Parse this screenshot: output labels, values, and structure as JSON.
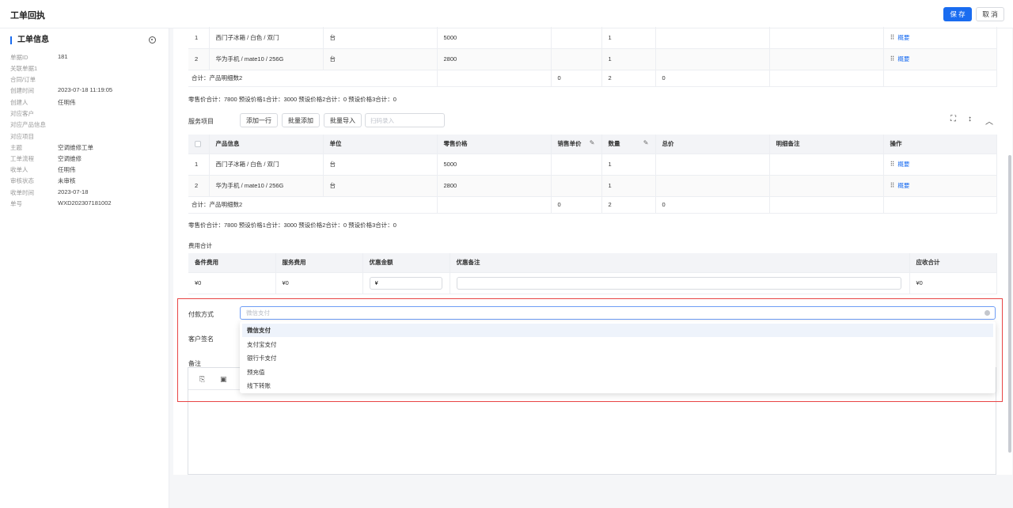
{
  "header": {
    "title": "工单回执",
    "save_label": "保 存",
    "cancel_label": "取 消"
  },
  "sidebar": {
    "title": "工单信息",
    "rows": [
      {
        "k": "单据ID",
        "v": "181"
      },
      {
        "k": "关联单据1",
        "v": ""
      },
      {
        "k": "合同/订单",
        "v": ""
      },
      {
        "k": "创建时间",
        "v": "2023-07-18 11:19:05"
      },
      {
        "k": "创建人",
        "v": "任明伟"
      },
      {
        "k": "对应客户",
        "v": ""
      },
      {
        "k": "对应产品信息",
        "v": ""
      },
      {
        "k": "对应项目",
        "v": ""
      },
      {
        "k": "主题",
        "v": "空调维修工单"
      },
      {
        "k": "工单流程",
        "v": "空调维修"
      },
      {
        "k": "收单人",
        "v": "任明伟"
      },
      {
        "k": "审核状态",
        "v": "未审核"
      },
      {
        "k": "收单时间",
        "v": "2023-07-18"
      },
      {
        "k": "单号",
        "v": "WXD202307181002"
      }
    ]
  },
  "product_table": {
    "rows": [
      {
        "idx": "1",
        "name": "西门子冰箱 / 白色 / 双门",
        "unit": "台",
        "price": "5000",
        "qty": "1",
        "op": "概要"
      },
      {
        "idx": "2",
        "name": "华为手机 / mate10 / 256G",
        "unit": "台",
        "price": "2800",
        "qty": "1",
        "op": "概要"
      }
    ],
    "sum": {
      "label": "合计：产品明细数2",
      "sale": "0",
      "qty": "2",
      "total": "0"
    },
    "summary_line": "零售价合计：7800  预设价格1合计：3000  预设价格2合计：0  预设价格3合计：0"
  },
  "service": {
    "label": "服务项目",
    "btn_add_row": "添加一行",
    "btn_batch_add": "批量添加",
    "btn_batch_import": "批量导入",
    "scan_placeholder": "扫码录入",
    "headers": {
      "product": "产品信息",
      "unit": "单位",
      "retail": "零售价格",
      "sale": "销售单价",
      "qty": "数量",
      "total": "总价",
      "remark": "明细备注",
      "op": "操作"
    },
    "rows": [
      {
        "idx": "1",
        "name": "西门子冰箱 / 白色 / 双门",
        "unit": "台",
        "price": "5000",
        "qty": "1",
        "op": "概要"
      },
      {
        "idx": "2",
        "name": "华为手机 / mate10 / 256G",
        "unit": "台",
        "price": "2800",
        "qty": "1",
        "op": "概要"
      }
    ],
    "sum": {
      "label": "合计：产品明细数2",
      "sale": "0",
      "qty": "2",
      "total": "0"
    },
    "summary_line": "零售价合计：7800  预设价格1合计：3000  预设价格2合计：0  预设价格3合计：0"
  },
  "fees": {
    "title": "费用合计",
    "headers": {
      "parts": "备件费用",
      "service": "服务费用",
      "discount": "优惠金额",
      "discount_note": "优惠备注",
      "receivable": "应收合计"
    },
    "parts": "¥0",
    "service": "¥0",
    "discount_value": "¥",
    "receivable": "¥0"
  },
  "form": {
    "pay_label": "付款方式",
    "pay_placeholder": "微信支付",
    "sign_label": "客户签名",
    "note_label": "备注",
    "options": [
      "微信支付",
      "支付宝支付",
      "银行卡支付",
      "预充值",
      "线下转账"
    ]
  }
}
